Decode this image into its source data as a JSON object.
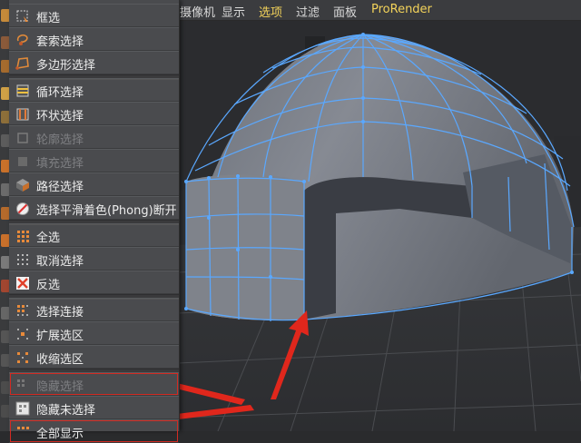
{
  "menubar": {
    "items": [
      {
        "label": "摄像机",
        "active": false
      },
      {
        "label": "显示",
        "active": false
      },
      {
        "label": "选项",
        "active": true
      },
      {
        "label": "过滤",
        "active": false
      },
      {
        "label": "面板",
        "active": false
      },
      {
        "label": "ProRender",
        "active": false
      }
    ]
  },
  "select_menu": {
    "items": [
      {
        "label": "框选",
        "icon": "box-select-icon",
        "enabled": true
      },
      {
        "label": "套索选择",
        "icon": "lasso-select-icon",
        "enabled": true
      },
      {
        "label": "多边形选择",
        "icon": "polygon-select-icon",
        "enabled": true
      },
      {
        "label": "循环选择",
        "icon": "loop-select-icon",
        "enabled": true
      },
      {
        "label": "环状选择",
        "icon": "ring-select-icon",
        "enabled": true
      },
      {
        "label": "轮廓选择",
        "icon": "outline-select-icon",
        "enabled": false
      },
      {
        "label": "填充选择",
        "icon": "fill-select-icon",
        "enabled": false
      },
      {
        "label": "路径选择",
        "icon": "path-select-icon",
        "enabled": true
      },
      {
        "label": "选择平滑着色(Phong)断开",
        "icon": "phong-break-select-icon",
        "enabled": true
      },
      {
        "label": "全选",
        "icon": "select-all-icon",
        "enabled": true
      },
      {
        "label": "取消选择",
        "icon": "deselect-all-icon",
        "enabled": true
      },
      {
        "label": "反选",
        "icon": "invert-selection-icon",
        "enabled": true
      },
      {
        "label": "选择连接",
        "icon": "select-connected-icon",
        "enabled": true
      },
      {
        "label": "扩展选区",
        "icon": "grow-selection-icon",
        "enabled": true
      },
      {
        "label": "收缩选区",
        "icon": "shrink-selection-icon",
        "enabled": true
      },
      {
        "label": "隐藏选择",
        "icon": "hide-selected-icon",
        "enabled": false
      },
      {
        "label": "隐藏未选择",
        "icon": "hide-unselected-icon",
        "enabled": true
      },
      {
        "label": "全部显示",
        "icon": "unhide-all-icon",
        "enabled": true
      }
    ]
  },
  "colors": {
    "accent_menu_active": "#f3d35a",
    "mesh_wire": "#5aa8ff",
    "annotation_red": "#e0271c"
  }
}
